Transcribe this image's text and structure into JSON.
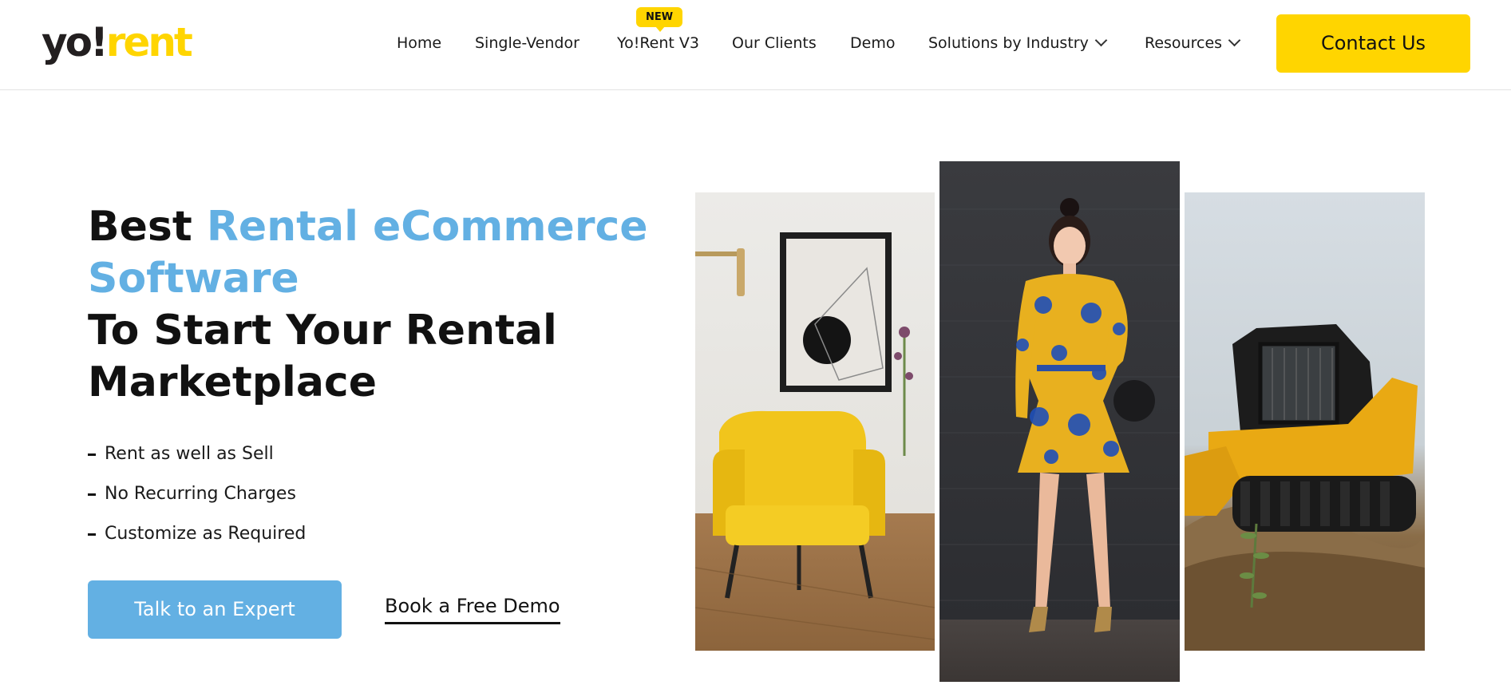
{
  "header": {
    "logo": {
      "part1": "yo!",
      "part2": "rent"
    },
    "nav": [
      {
        "label": "Home"
      },
      {
        "label": "Single-Vendor"
      },
      {
        "label": "Yo!Rent V3",
        "badge": "NEW"
      },
      {
        "label": "Our Clients"
      },
      {
        "label": "Demo"
      },
      {
        "label": "Solutions by Industry",
        "dropdown": true
      },
      {
        "label": "Resources",
        "dropdown": true
      }
    ],
    "contact_label": "Contact Us"
  },
  "hero": {
    "title_part1": "Best ",
    "title_highlight": "Rental eCommerce Software",
    "title_part2": "To Start Your Rental Marketplace",
    "bullets": [
      "Rent as well as Sell",
      "No Recurring Charges",
      "Customize as Required"
    ],
    "primary_cta": "Talk to an Expert",
    "secondary_cta": "Book a Free Demo"
  },
  "colors": {
    "brand_yellow": "#ffd500",
    "accent_blue": "#63b0e3",
    "text_dark": "#111111"
  }
}
